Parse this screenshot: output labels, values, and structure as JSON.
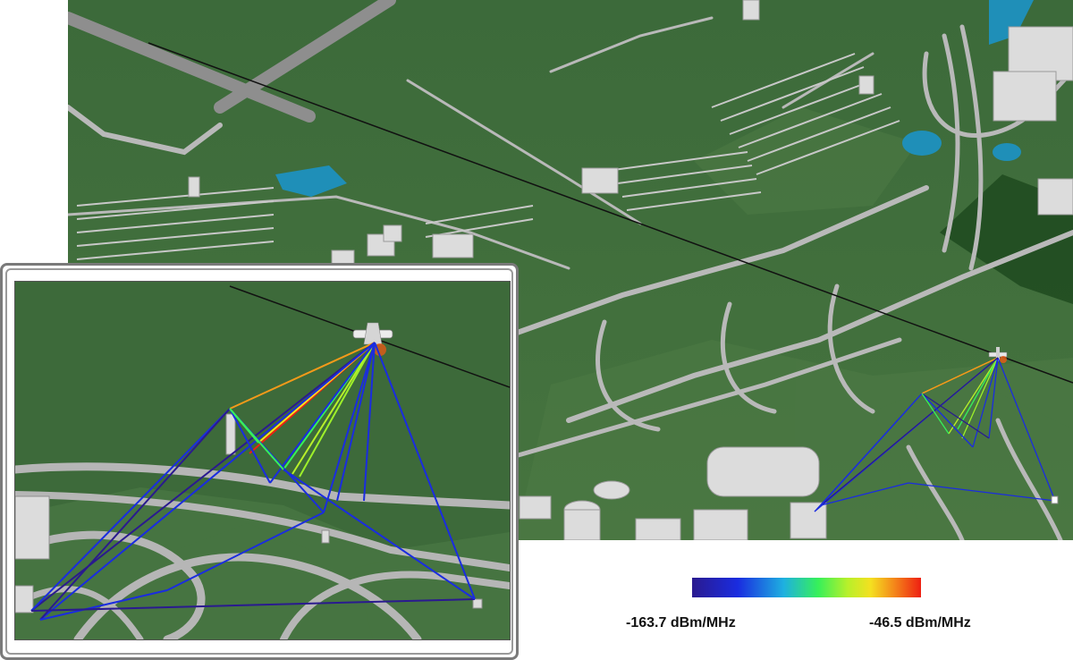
{
  "legend": {
    "min_label": "-163.7 dBm/MHz",
    "max_label": "-46.5 dBm/MHz",
    "colors": [
      "#2a1a8f",
      "#1a2ce0",
      "#1eb0e0",
      "#36f05a",
      "#b8f02a",
      "#f4e020",
      "#f48a1a",
      "#ee1f12"
    ]
  },
  "scene": {
    "terrain_color": "#3f6b3c",
    "road_color": "#b9b9b9",
    "water_color": "#1f8fb8",
    "building_color": "#dcdcdc",
    "flight_path_color": "#111111"
  }
}
